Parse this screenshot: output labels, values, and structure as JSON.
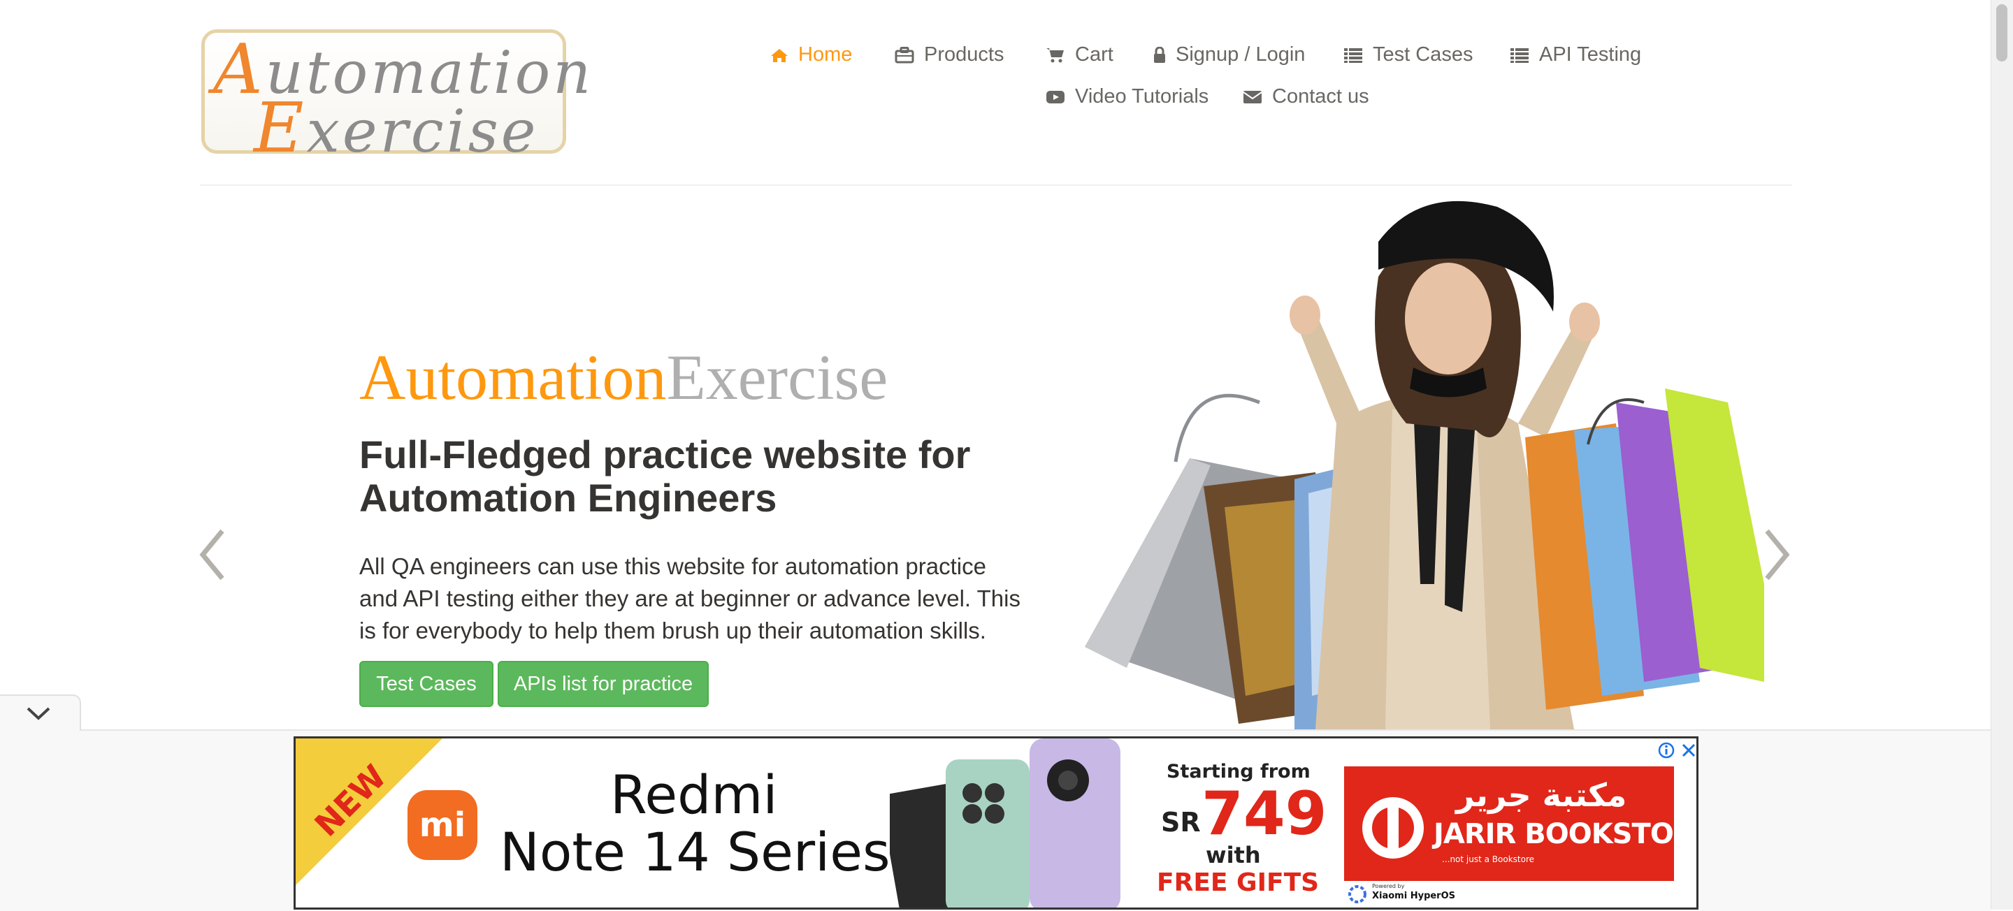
{
  "logo": {
    "line1": "Automation",
    "line2": "Exercise"
  },
  "nav": {
    "row1": [
      {
        "label": "Home",
        "icon": "home-icon",
        "active": true
      },
      {
        "label": "Products",
        "icon": "briefcase-icon"
      },
      {
        "label": "Cart",
        "icon": "cart-icon"
      },
      {
        "label": "Signup / Login",
        "icon": "lock-icon"
      },
      {
        "label": "Test Cases",
        "icon": "list-icon"
      },
      {
        "label": "API Testing",
        "icon": "list-icon"
      }
    ],
    "row2": [
      {
        "label": "Video Tutorials",
        "icon": "youtube-play-icon"
      },
      {
        "label": "Contact us",
        "icon": "envelope-icon"
      }
    ]
  },
  "hero": {
    "brand_part1": "Automation",
    "brand_part2": "Exercise",
    "heading": "Full-Fledged practice website for Automation Engineers",
    "description": "All QA engineers can use this website for automation practice and API testing either they are at beginner or advance level. This is for everybody to help them brush up their automation skills.",
    "btn_test_cases": "Test Cases",
    "btn_apis": "APIs list for practice",
    "prev_icon": "chevron-left-icon",
    "next_icon": "chevron-right-icon"
  },
  "ad": {
    "badge": "NEW",
    "brand_logo": "mi",
    "title_line1": "Redmi",
    "title_line2": "Note 14 Series",
    "starting_from": "Starting from",
    "currency": "SR",
    "price": "749",
    "with": "with",
    "free_gifts": "FREE GIFTS",
    "store_arabic": "مكتبة جرير",
    "store_name": "JARIR BOOKSTORE",
    "store_tagline": "...not just a Bookstore",
    "powered_by": "Powered by",
    "powered_brand": "Xiaomi HyperOS"
  },
  "colors": {
    "accent": "#fe980f",
    "button_green": "#5cb85c",
    "text_dark": "#363432",
    "text_nav": "#696763",
    "brand_grey": "#b0afaf",
    "ad_red": "#e0271a",
    "ad_yellow": "#f4cd3c"
  }
}
